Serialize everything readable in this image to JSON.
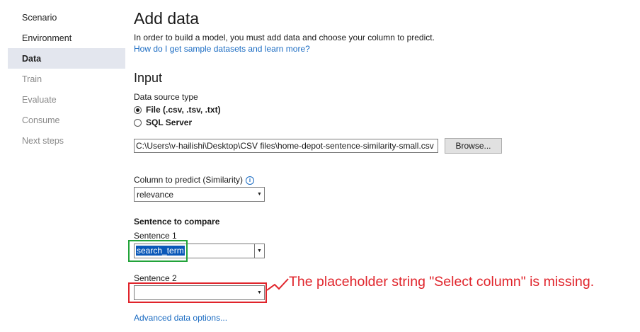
{
  "sidebar": {
    "items": [
      {
        "label": "Scenario"
      },
      {
        "label": "Environment"
      },
      {
        "label": "Data"
      },
      {
        "label": "Train"
      },
      {
        "label": "Evaluate"
      },
      {
        "label": "Consume"
      },
      {
        "label": "Next steps"
      }
    ]
  },
  "main": {
    "title": "Add data",
    "description": "In order to build a model, you must add data and choose your column to predict.",
    "help_link": "How do I get sample datasets and learn more?",
    "input_heading": "Input",
    "data_source_label": "Data source type",
    "radio_file": "File (.csv, .tsv, .txt)",
    "radio_sql": "SQL Server",
    "file_path": "C:\\Users\\v-hailishi\\Desktop\\CSV files\\home-depot-sentence-similarity-small.csv",
    "browse_label": "Browse...",
    "predict_label": "Column to predict (Similarity)",
    "predict_value": "relevance",
    "sentence_heading": "Sentence to compare",
    "sentence1_label": "Sentence 1",
    "sentence1_value": "search_term",
    "sentence2_label": "Sentence 2",
    "sentence2_value": "",
    "advanced_link": "Advanced data options..."
  },
  "annotation": {
    "text": "The placeholder string \"Select column\" is missing.",
    "color": "#e0242b",
    "highlight_ok_color": "#22a33a"
  },
  "colors": {
    "accent": "#1a6bc2",
    "selected_nav_bg": "#e3e6ee",
    "selection_bg": "#0a58b8"
  }
}
